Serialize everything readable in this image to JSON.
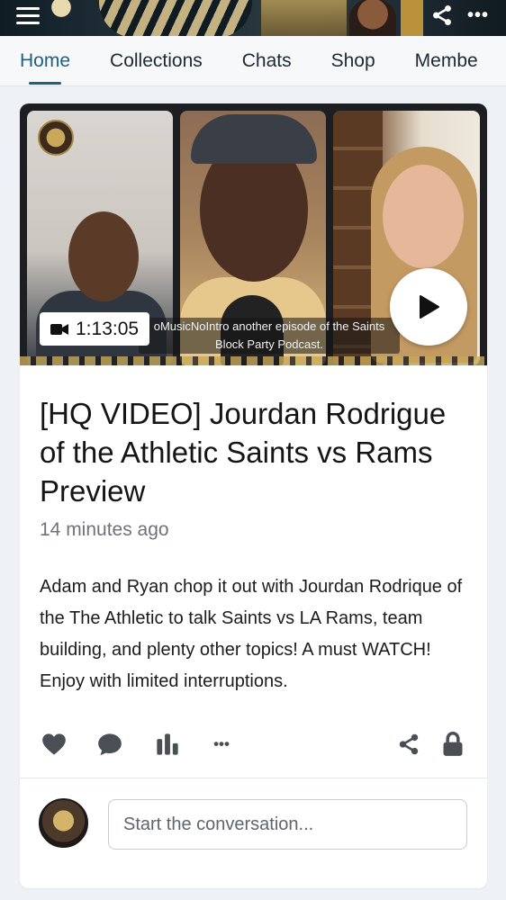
{
  "header": {
    "menu_icon": "hamburger-icon",
    "share_icon": "share-icon",
    "more_icon": "more-horizontal-icon",
    "more_glyph": "•••"
  },
  "tabs": [
    {
      "label": "Home",
      "active": true
    },
    {
      "label": "Collections",
      "active": false
    },
    {
      "label": "Chats",
      "active": false
    },
    {
      "label": "Shop",
      "active": false
    },
    {
      "label": "Membe",
      "active": false
    }
  ],
  "post": {
    "video": {
      "duration": "1:13:05",
      "caption_line1": "oMusicNoIntro another episode of the Saints",
      "caption_line2": "Block Party Podcast."
    },
    "title": "[HQ VIDEO] Jourdan Rodrigue of the Athletic Saints vs Rams Preview",
    "timestamp": "14 minutes ago",
    "description": "Adam and Ryan chop it out with Jourdan Rodrique of the The Athletic to talk Saints vs LA Rams, team building, and plenty other topics! A must WATCH! Enjoy with limited interruptions.",
    "actions": {
      "like_icon": "heart-icon",
      "comment_icon": "comment-icon",
      "stats_icon": "bar-chart-icon",
      "more_icon": "more-horizontal-icon",
      "more_glyph": "•••",
      "share_icon": "share-icon",
      "lock_icon": "lock-icon"
    },
    "comment": {
      "placeholder": "Start the conversation..."
    }
  },
  "colors": {
    "accent": "#1f5f80",
    "background": "#eef1f5",
    "card": "#ffffff",
    "icon": "#4a4f55"
  }
}
